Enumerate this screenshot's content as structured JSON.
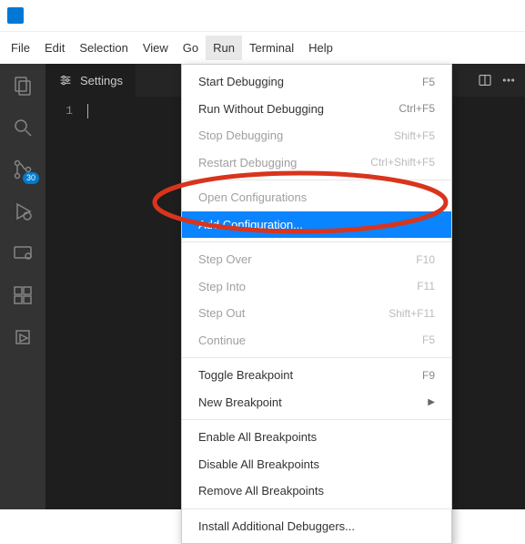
{
  "menubar": {
    "items": [
      "File",
      "Edit",
      "Selection",
      "View",
      "Go",
      "Run",
      "Terminal",
      "Help"
    ],
    "active_index": 5
  },
  "activity_bar": {
    "badge_value": "30"
  },
  "tab": {
    "label": "Settings"
  },
  "editor": {
    "line_number": "1"
  },
  "run_menu": {
    "items": [
      {
        "label": "Start Debugging",
        "shortcut": "F5",
        "enabled": true
      },
      {
        "label": "Run Without Debugging",
        "shortcut": "Ctrl+F5",
        "enabled": true
      },
      {
        "label": "Stop Debugging",
        "shortcut": "Shift+F5",
        "enabled": false
      },
      {
        "label": "Restart Debugging",
        "shortcut": "Ctrl+Shift+F5",
        "enabled": false
      },
      {
        "sep": true
      },
      {
        "label": "Open Configurations",
        "shortcut": "",
        "enabled": false
      },
      {
        "label": "Add Configuration...",
        "shortcut": "",
        "enabled": true,
        "highlight": true
      },
      {
        "sep": true
      },
      {
        "label": "Step Over",
        "shortcut": "F10",
        "enabled": false
      },
      {
        "label": "Step Into",
        "shortcut": "F11",
        "enabled": false
      },
      {
        "label": "Step Out",
        "shortcut": "Shift+F11",
        "enabled": false
      },
      {
        "label": "Continue",
        "shortcut": "F5",
        "enabled": false
      },
      {
        "sep": true
      },
      {
        "label": "Toggle Breakpoint",
        "shortcut": "F9",
        "enabled": true
      },
      {
        "label": "New Breakpoint",
        "shortcut": "",
        "enabled": true,
        "submenu": true
      },
      {
        "sep": true
      },
      {
        "label": "Enable All Breakpoints",
        "shortcut": "",
        "enabled": true
      },
      {
        "label": "Disable All Breakpoints",
        "shortcut": "",
        "enabled": true
      },
      {
        "label": "Remove All Breakpoints",
        "shortcut": "",
        "enabled": true
      },
      {
        "sep": true
      },
      {
        "label": "Install Additional Debuggers...",
        "shortcut": "",
        "enabled": true
      }
    ]
  }
}
